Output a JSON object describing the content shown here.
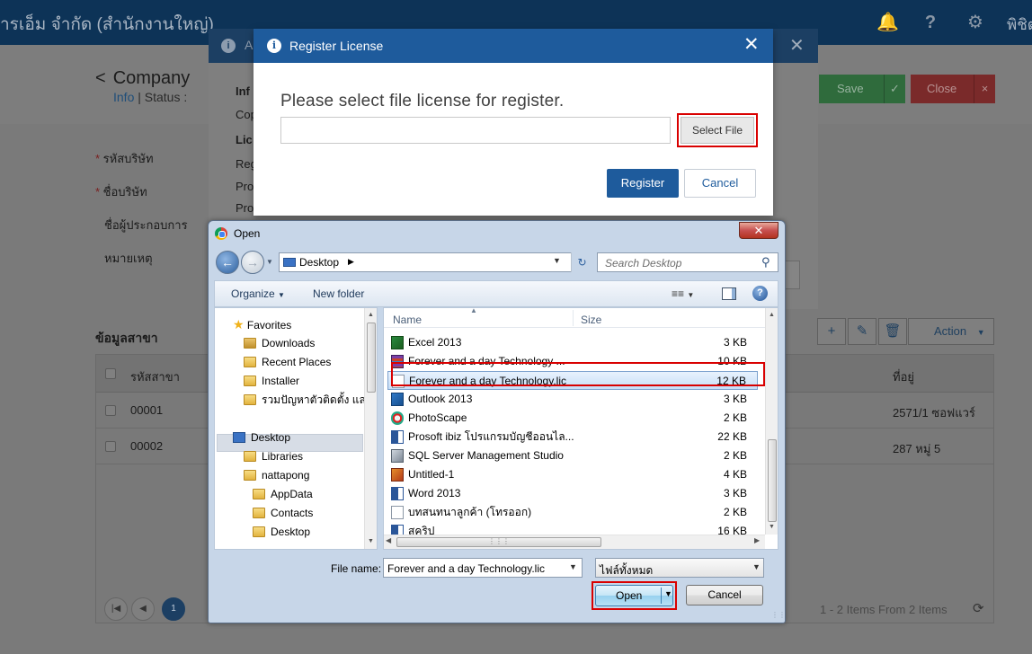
{
  "topbar": {
    "title": "ารเอ็ม จำกัด (สำนักงานใหญ่)",
    "user": "พิชิต",
    "icons": [
      "bell-icon",
      "help-icon",
      "gear-icon"
    ]
  },
  "page": {
    "back_glyph": "<",
    "title": "Company",
    "subnav": [
      "Info",
      "Status :"
    ],
    "save_label": "Save",
    "close_label": "Close",
    "fields": [
      "รหัสบริษัท",
      "ชื่อบริษัท",
      "ชื่อผู้ประกอบการ",
      "หมายเหตุ"
    ],
    "branch_title": "ข้อมูลสาขา",
    "action_label": "Action",
    "grid": {
      "headers": [
        "รหัสสาขา",
        "ที่อยู่"
      ],
      "rows": [
        {
          "code": "00001",
          "address": "2571/1 ซอฟแวร์"
        },
        {
          "code": "00002",
          "address": "287 หมู่ 5"
        }
      ],
      "page": "1",
      "info": "1 - 2 Items From 2 Items"
    }
  },
  "mid_modal": {
    "title": "A",
    "labels": [
      "Inf",
      "Cop",
      "Lic",
      "Reg",
      "Pro",
      "Pro"
    ]
  },
  "register": {
    "title": "Register License",
    "prompt": "Please select file license for register.",
    "file_value": "",
    "select_file_label": "Select File",
    "register_label": "Register",
    "cancel_label": "Cancel"
  },
  "open_dialog": {
    "title": "Open",
    "path": "Desktop",
    "search_placeholder": "Search Desktop",
    "organize_label": "Organize",
    "new_folder_label": "New folder",
    "tree": [
      {
        "label": "Favorites",
        "icon": "star-icon"
      },
      {
        "label": "Downloads",
        "icon": "folder-icon"
      },
      {
        "label": "Recent Places",
        "icon": "folder-icon"
      },
      {
        "label": "Installer",
        "icon": "folder-icon"
      },
      {
        "label": "รวมปัญหาตัวติดตั้ง และ I",
        "icon": "folder-icon"
      },
      {
        "label": "Desktop",
        "icon": "desktop-icon"
      },
      {
        "label": "Libraries",
        "icon": "folder-icon"
      },
      {
        "label": "nattapong",
        "icon": "folder-icon"
      },
      {
        "label": "AppData",
        "icon": "folder-icon"
      },
      {
        "label": "Contacts",
        "icon": "folder-icon"
      },
      {
        "label": "Desktop",
        "icon": "folder-icon"
      }
    ],
    "col_name": "Name",
    "col_size": "Size",
    "files": [
      {
        "name": "Excel 2013",
        "size": "3 KB",
        "icon": "excel-icon"
      },
      {
        "name": "Forever and a day Technology ...",
        "size": "10 KB",
        "icon": "archive-icon"
      },
      {
        "name": "Forever and a day Technology.lic",
        "size": "12 KB",
        "icon": "file-icon",
        "selected": true
      },
      {
        "name": "Outlook 2013",
        "size": "3 KB",
        "icon": "outlook-icon"
      },
      {
        "name": "PhotoScape",
        "size": "2 KB",
        "icon": "photoscape-icon"
      },
      {
        "name": "Prosoft ibiz โปรแกรมบัญชีออนไล...",
        "size": "22 KB",
        "icon": "word-icon"
      },
      {
        "name": "SQL Server Management Studio",
        "size": "2 KB",
        "icon": "sql-icon"
      },
      {
        "name": "Untitled-1",
        "size": "4 KB",
        "icon": "image-icon"
      },
      {
        "name": "Word 2013",
        "size": "3 KB",
        "icon": "word-icon"
      },
      {
        "name": "บทสนทนาลูกค้า (โทรออก)",
        "size": "2 KB",
        "icon": "document-icon"
      },
      {
        "name": "สคริป",
        "size": "16 KB",
        "icon": "word-icon"
      }
    ],
    "filename_label": "File name:",
    "filename_value": "Forever and a day Technology.lic",
    "filetype_value": "ไฟล์ทั้งหมด",
    "open_label": "Open",
    "cancel_label": "Cancel"
  }
}
